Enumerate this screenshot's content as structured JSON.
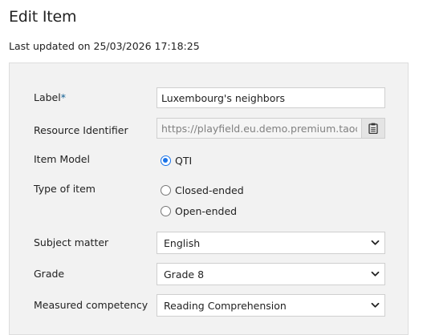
{
  "page": {
    "title": "Edit Item",
    "last_updated": "Last updated on 25/03/2026 17:18:25"
  },
  "form": {
    "label": {
      "text": "Label",
      "required_mark": "*",
      "value": "Luxembourg's neighbors"
    },
    "resource_identifier": {
      "text": "Resource Identifier",
      "value": "https://playfield.eu.demo.premium.taocloud"
    },
    "item_model": {
      "text": "Item Model",
      "options": [
        {
          "label": "QTI",
          "checked": true
        }
      ]
    },
    "type_of_item": {
      "text": "Type of item",
      "options": [
        {
          "label": "Closed-ended",
          "checked": false
        },
        {
          "label": "Open-ended",
          "checked": false
        }
      ]
    },
    "subject_matter": {
      "text": "Subject matter",
      "selected": "English"
    },
    "grade": {
      "text": "Grade",
      "selected": "Grade 8"
    },
    "measured_competency": {
      "text": "Measured competency",
      "selected": "Reading Comprehension"
    }
  },
  "icons": {
    "copy": "clipboard-icon",
    "dropdown": "chevron-down-icon"
  },
  "colors": {
    "accent": "#1a73e8",
    "required": "#0e5d91",
    "panel": "#f2f2f2"
  }
}
